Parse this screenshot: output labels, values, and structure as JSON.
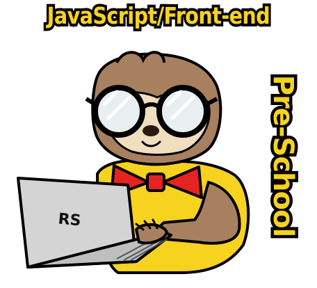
{
  "banner": {
    "title": "JavaScript/Front-end",
    "subtitle": "Pre-School"
  },
  "laptop": {
    "label": "RS"
  },
  "colors": {
    "title_fill": "#f7d21e",
    "outline": "#000000",
    "sloth_fur": "#a7805f",
    "sloth_face": "#f1dec0",
    "shirt": "#f7d21e",
    "bowtie": "#e62323",
    "laptop": "#d8d8d8"
  },
  "icons": [
    "sloth-mascot-illustration",
    "laptop-icon",
    "bowtie-icon",
    "glasses-icon"
  ]
}
